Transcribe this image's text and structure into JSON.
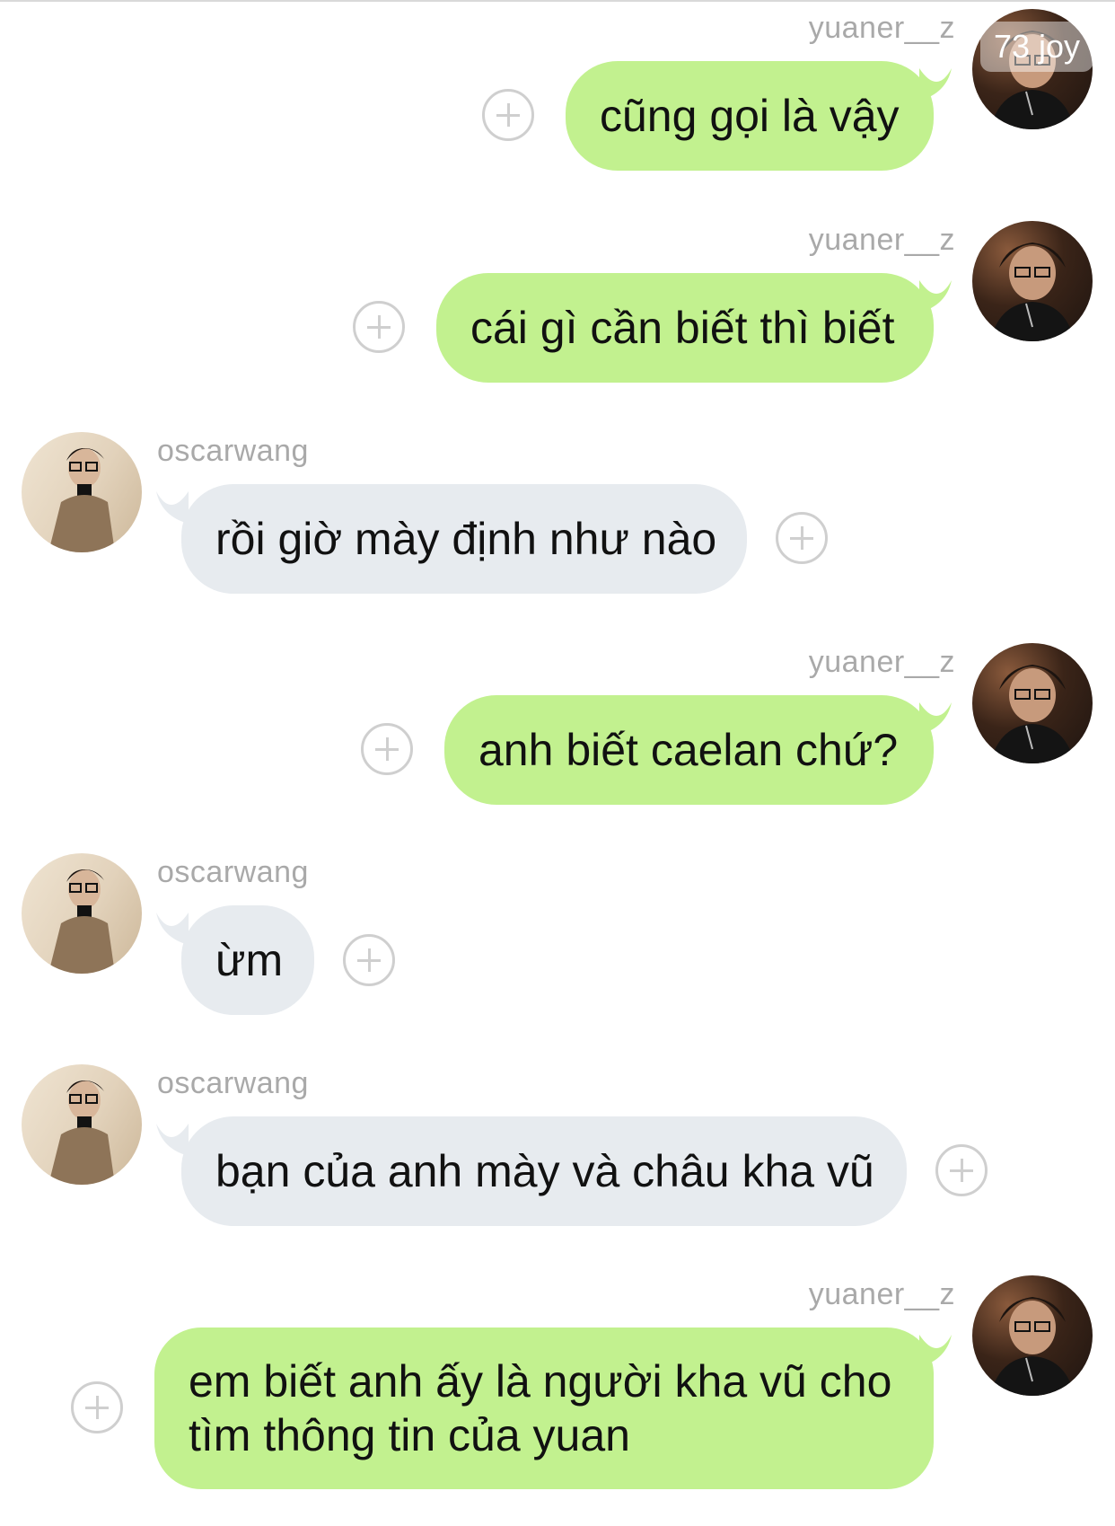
{
  "chat": {
    "overlay_badge": "73 joy",
    "messages": [
      {
        "sender": "yuaner__z",
        "text": "cũng gọi là vậy",
        "side": "right"
      },
      {
        "sender": "yuaner__z",
        "text": "cái gì cần biết thì biết",
        "side": "right"
      },
      {
        "sender": "oscarwang",
        "text": "rồi giờ mày định như nào",
        "side": "left"
      },
      {
        "sender": "yuaner__z",
        "text": "anh biết caelan chứ?",
        "side": "right"
      },
      {
        "sender": "oscarwang",
        "text": "ừm",
        "side": "left"
      },
      {
        "sender": "oscarwang",
        "text": "bạn của anh mày và châu kha vũ",
        "side": "left"
      },
      {
        "sender": "yuaner__z",
        "lines": [
          "em biết anh ấy là người kha vũ cho",
          "tìm thông tin của yuan"
        ],
        "side": "right"
      }
    ]
  },
  "colors": {
    "outgoing_bubble": "#c2f18f",
    "incoming_bubble": "#e7ebef",
    "sender_name": "#a9a9a9",
    "add_icon": "#cfcfcf"
  }
}
